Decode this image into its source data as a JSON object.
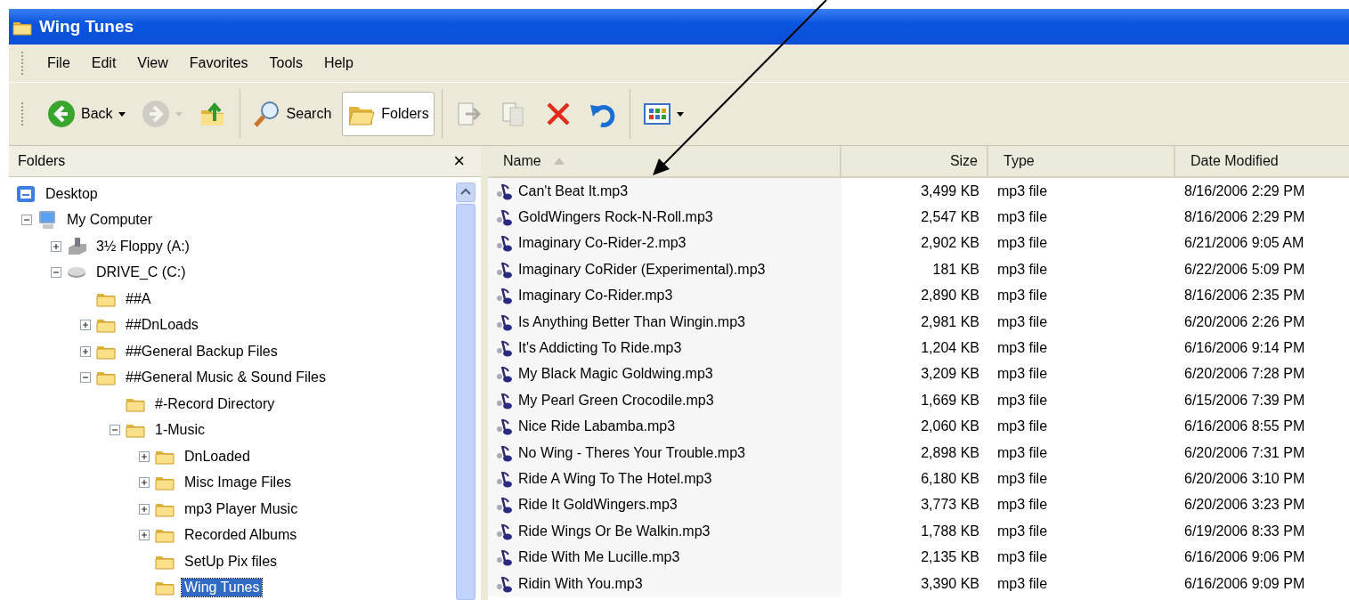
{
  "window": {
    "title": "Wing Tunes"
  },
  "menu": [
    "File",
    "Edit",
    "View",
    "Favorites",
    "Tools",
    "Help"
  ],
  "toolbar": {
    "groups": [
      [
        {
          "kind": "back",
          "label": "Back",
          "dropdown": true,
          "disabled": false,
          "selected": false
        },
        {
          "kind": "forward",
          "dropdown": true,
          "disabled": true,
          "selected": false
        },
        {
          "kind": "up",
          "disabled": false,
          "selected": false
        }
      ],
      [
        {
          "kind": "search",
          "label": "Search",
          "disabled": false,
          "selected": false
        },
        {
          "kind": "folders",
          "label": "Folders",
          "disabled": false,
          "selected": true
        }
      ],
      [
        {
          "kind": "move",
          "disabled": true,
          "selected": false
        },
        {
          "kind": "copy",
          "disabled": true,
          "selected": false
        },
        {
          "kind": "delete",
          "disabled": false,
          "selected": false
        },
        {
          "kind": "undo",
          "disabled": false,
          "selected": false
        }
      ],
      [
        {
          "kind": "views",
          "dropdown": true,
          "disabled": false,
          "selected": false
        }
      ]
    ]
  },
  "folders_pane": {
    "title": "Folders",
    "close": "×",
    "tree": [
      {
        "kind": "desktop",
        "label": "Desktop",
        "selected": false,
        "children": [
          {
            "kind": "computer",
            "label": "My Computer",
            "expanded": true,
            "selected": false,
            "children": [
              {
                "kind": "floppy",
                "label": "3½ Floppy (A:)",
                "expanded": false,
                "selected": false
              },
              {
                "kind": "drive",
                "label": "DRIVE_C (C:)",
                "expanded": true,
                "selected": false,
                "children": [
                  {
                    "kind": "folder",
                    "label": "##A",
                    "selected": false
                  },
                  {
                    "kind": "folder",
                    "label": "##DnLoads",
                    "expanded": false,
                    "selected": false
                  },
                  {
                    "kind": "folder",
                    "label": "##General Backup Files",
                    "expanded": false,
                    "selected": false
                  },
                  {
                    "kind": "folder",
                    "label": "##General Music & Sound Files",
                    "expanded": true,
                    "selected": false,
                    "children": [
                      {
                        "kind": "folder",
                        "label": "#-Record Directory",
                        "selected": false
                      },
                      {
                        "kind": "folder",
                        "label": "1-Music",
                        "expanded": true,
                        "selected": false,
                        "children": [
                          {
                            "kind": "folder",
                            "label": "DnLoaded",
                            "expanded": false,
                            "selected": false
                          },
                          {
                            "kind": "folder",
                            "label": "Misc Image Files",
                            "expanded": false,
                            "selected": false
                          },
                          {
                            "kind": "folder",
                            "label": "mp3 Player Music",
                            "expanded": false,
                            "selected": false
                          },
                          {
                            "kind": "folder",
                            "label": "Recorded Albums",
                            "expanded": false,
                            "selected": false
                          },
                          {
                            "kind": "folder",
                            "label": "SetUp Pix files",
                            "selected": false
                          },
                          {
                            "kind": "folder",
                            "label": "Wing Tunes",
                            "selected": true
                          }
                        ]
                      }
                    ]
                  }
                ]
              }
            ]
          }
        ]
      }
    ]
  },
  "file_list": {
    "columns": [
      {
        "label": "Name",
        "sorted": true
      },
      {
        "label": "Size",
        "sorted": false
      },
      {
        "label": "Type",
        "sorted": false
      },
      {
        "label": "Date Modified",
        "sorted": false
      }
    ],
    "rows": [
      {
        "name": "Can't Beat It.mp3",
        "size": "3,499 KB",
        "type": "mp3 file",
        "date": "8/16/2006 2:29 PM"
      },
      {
        "name": "GoldWingers Rock-N-Roll.mp3",
        "size": "2,547 KB",
        "type": "mp3 file",
        "date": "8/16/2006 2:29 PM"
      },
      {
        "name": "Imaginary Co-Rider-2.mp3",
        "size": "2,902 KB",
        "type": "mp3 file",
        "date": "6/21/2006 9:05 AM"
      },
      {
        "name": "Imaginary CoRider (Experimental).mp3",
        "size": "181 KB",
        "type": "mp3 file",
        "date": "6/22/2006 5:09 PM"
      },
      {
        "name": "Imaginary Co-Rider.mp3",
        "size": "2,890 KB",
        "type": "mp3 file",
        "date": "8/16/2006 2:35 PM"
      },
      {
        "name": "Is Anything Better Than Wingin.mp3",
        "size": "2,981 KB",
        "type": "mp3 file",
        "date": "6/20/2006 2:26 PM"
      },
      {
        "name": "It's Addicting To Ride.mp3",
        "size": "1,204 KB",
        "type": "mp3 file",
        "date": "6/16/2006 9:14 PM"
      },
      {
        "name": "My Black Magic Goldwing.mp3",
        "size": "3,209 KB",
        "type": "mp3 file",
        "date": "6/20/2006 7:28 PM"
      },
      {
        "name": "My Pearl Green Crocodile.mp3",
        "size": "1,669 KB",
        "type": "mp3 file",
        "date": "6/15/2006 7:39 PM"
      },
      {
        "name": "Nice Ride Labamba.mp3",
        "size": "2,060 KB",
        "type": "mp3 file",
        "date": "6/16/2006 8:55 PM"
      },
      {
        "name": "No Wing - Theres Your Trouble.mp3",
        "size": "2,898 KB",
        "type": "mp3 file",
        "date": "6/20/2006 7:31 PM"
      },
      {
        "name": "Ride A Wing To The Hotel.mp3",
        "size": "6,180 KB",
        "type": "mp3 file",
        "date": "6/20/2006 3:10 PM"
      },
      {
        "name": "Ride It GoldWingers.mp3",
        "size": "3,773 KB",
        "type": "mp3 file",
        "date": "6/20/2006 3:23 PM"
      },
      {
        "name": "Ride Wings Or Be Walkin.mp3",
        "size": "1,788 KB",
        "type": "mp3 file",
        "date": "6/19/2006 8:33 PM"
      },
      {
        "name": "Ride With Me Lucille.mp3",
        "size": "2,135 KB",
        "type": "mp3 file",
        "date": "6/16/2006 9:06 PM"
      },
      {
        "name": "Ridin With You.mp3",
        "size": "3,390 KB",
        "type": "mp3 file",
        "date": "6/16/2006 9:09 PM"
      }
    ]
  }
}
